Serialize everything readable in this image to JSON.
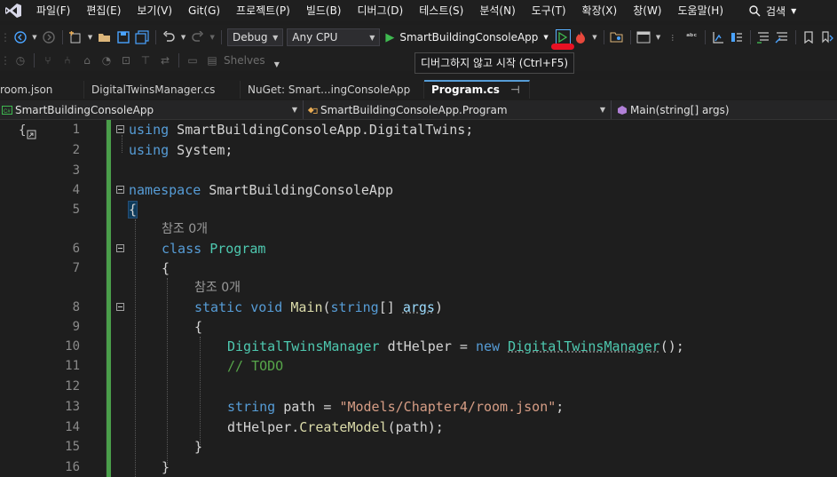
{
  "menu": {
    "items": [
      "파일(F)",
      "편집(E)",
      "보기(V)",
      "Git(G)",
      "프로젝트(P)",
      "빌드(B)",
      "디버그(D)",
      "테스트(S)",
      "분석(N)",
      "도구(T)",
      "확장(X)",
      "창(W)",
      "도움말(H)"
    ],
    "search_label": "검색"
  },
  "toolbar": {
    "configuration": "Debug",
    "platform": "Any CPU",
    "startup_project": "SmartBuildingConsoleApp",
    "shelves_label": "Shelves"
  },
  "tooltip": "디버그하지 않고 시작 (Ctrl+F5)",
  "tabs": [
    {
      "label": "room.json",
      "active": false
    },
    {
      "label": "DigitalTwinsManager.cs",
      "active": false
    },
    {
      "label": "NuGet: Smart...ingConsoleApp",
      "active": false
    },
    {
      "label": "Program.cs",
      "active": true,
      "pin": "⊣",
      "close": "✕"
    }
  ],
  "navbar": {
    "project": "SmartBuildingConsoleApp",
    "type": "SmartBuildingConsoleApp.Program",
    "member": "Main(string[] args)"
  },
  "editor": {
    "lens_text": "참조 0개",
    "line_numbers": [
      "1",
      "2",
      "3",
      "4",
      "5",
      "6",
      "7",
      "8",
      "9",
      "10",
      "11",
      "12",
      "13",
      "14",
      "15",
      "16"
    ],
    "tokens": {
      "using": "using",
      "ns1": " SmartBuildingConsoleApp.DigitalTwins;",
      "ns2": " System;",
      "namespace": "namespace",
      "ns_name": " SmartBuildingConsoleApp",
      "open_brace": "{",
      "close_brace": "}",
      "class": "class",
      "class_name": "Program",
      "static": "static",
      "void": "void",
      "main": "Main",
      "paren_open": "(",
      "string": "string",
      "brackets": "[] ",
      "args": "args",
      "paren_close": ")",
      "dtm_type": "DigitalTwinsManager",
      "dt_decl": " dtHelper = ",
      "new": "new",
      "dtm_ctor": "DigitalTwinsManager",
      "ctor_end": "();",
      "todo": "// TODO",
      "path_decl": " path = ",
      "path_str": "\"Models/Chapter4/room.json\"",
      "semicolon": ";",
      "helper": "dtHelper.",
      "create_model": "CreateModel",
      "create_args": "(path);"
    }
  },
  "colors": {
    "keyword": "#569cd6",
    "type": "#4ec9b0",
    "method": "#dcdcaa",
    "string": "#d69d85",
    "comment": "#57a64a",
    "change_bar": "#4a9e4a",
    "accent": "#5ab0ff",
    "marker": "#e81123"
  },
  "icons": {
    "logo": "visual-studio-logo-icon",
    "search": "search-icon",
    "run": "play-icon",
    "hot_reload": "hot-reload-icon"
  }
}
